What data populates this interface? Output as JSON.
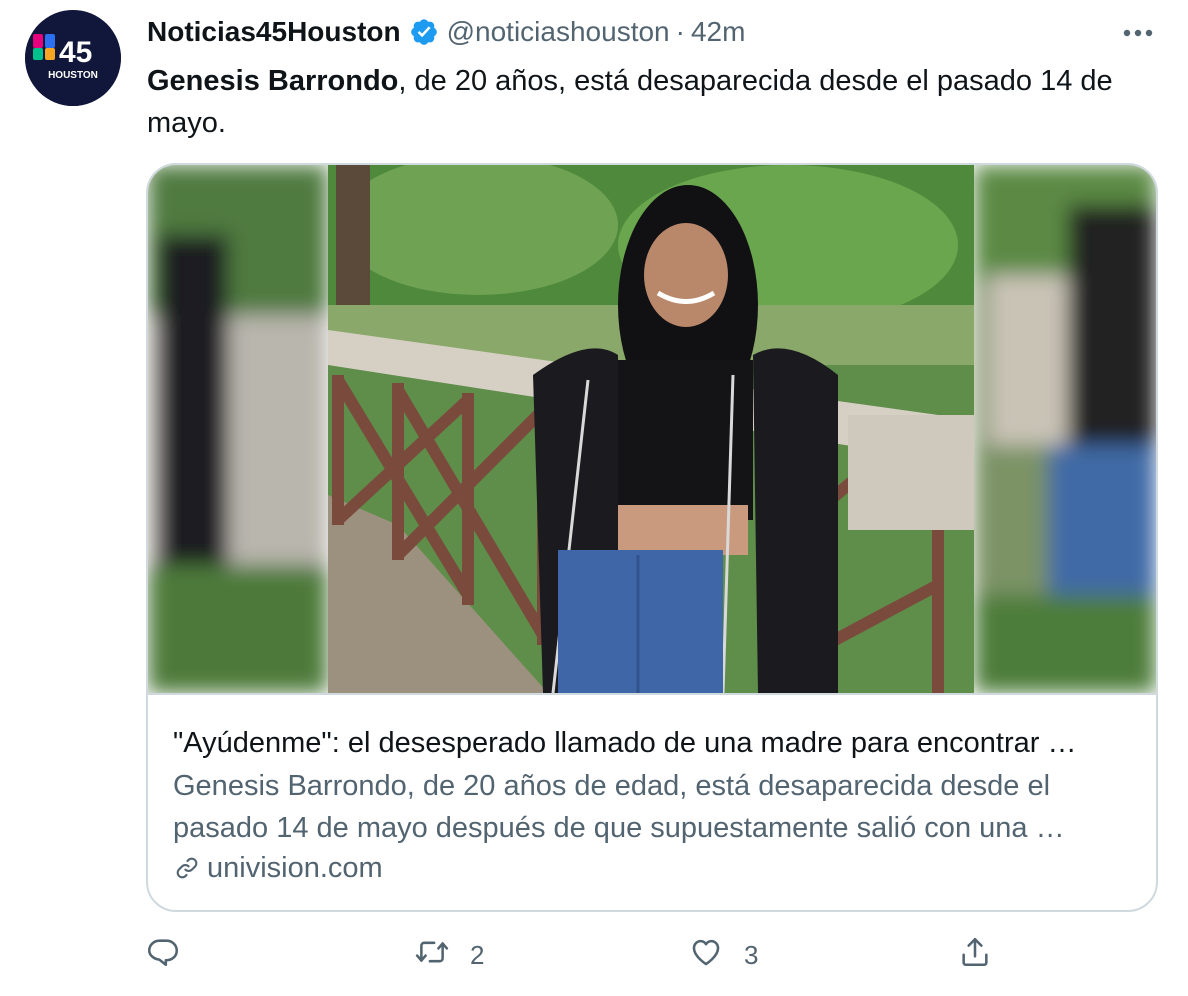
{
  "account": {
    "display_name": "Noticias45Houston",
    "handle": "@noticiashouston",
    "separator": "·",
    "time": "42m",
    "avatar": {
      "number": "45",
      "city": "HOUSTON"
    },
    "verified": true
  },
  "tweet": {
    "name_bold": "Genesis Barrondo",
    "text_rest": ", de 20 años, está desaparecida desde el pasado 14 de mayo."
  },
  "card": {
    "image_icon": "photo-of-young-woman-on-bridge",
    "title": "\"Ayúdenme\": el desesperado llamado de una madre para encontrar …",
    "description_line1": "Genesis Barrondo, de 20 años de edad, está desaparecida desde el",
    "description_line2": "pasado 14 de mayo después de que supuestamente salió con una …",
    "domain": "univision.com"
  },
  "actions": {
    "reply_icon": "reply-icon",
    "retweet_icon": "retweet-icon",
    "retweet_count": "2",
    "like_icon": "heart-icon",
    "like_count": "3",
    "share_icon": "share-icon"
  },
  "colors": {
    "text_primary": "#0f1419",
    "text_secondary": "#536471",
    "verified_blue": "#1d9bf0",
    "border": "#cfd9de",
    "avatar_bg": "#11173a"
  }
}
